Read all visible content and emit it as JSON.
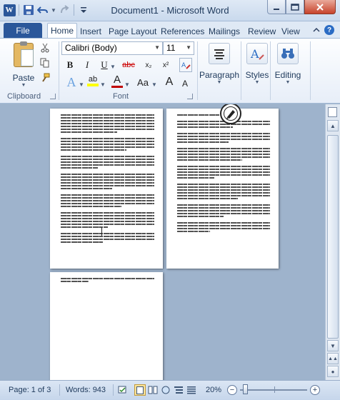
{
  "window": {
    "title": "Document1  -  Microsoft Word",
    "controls": [
      "minimize",
      "maximize",
      "close"
    ]
  },
  "quick_access": {
    "app_icon": "W",
    "items": [
      "save-icon",
      "undo-icon",
      "redo-icon",
      "customize-icon"
    ]
  },
  "tabs": {
    "file": "File",
    "items": [
      "Home",
      "Insert",
      "Page Layout",
      "References",
      "Mailings",
      "Review",
      "View"
    ],
    "active": "Home"
  },
  "ribbon": {
    "clipboard": {
      "paste_label": "Paste",
      "group_label": "Clipboard"
    },
    "font": {
      "family": "Calibri (Body)",
      "size": "11",
      "group_label": "Font",
      "buttons": [
        "B",
        "I",
        "U",
        "abc",
        "x₂",
        "x²",
        "A",
        "ab",
        "A",
        "Aa",
        "A",
        "A"
      ]
    },
    "paragraph": {
      "label": "Paragraph"
    },
    "styles": {
      "label": "Styles"
    },
    "editing": {
      "label": "Editing"
    }
  },
  "status": {
    "page": "Page: 1 of 3",
    "words": "Words: 943",
    "zoom": "20%",
    "zoom_level": 0.2
  },
  "colors": {
    "file_tab": "#2b579a",
    "highlight": "#ffff00",
    "font_color": "#c00000",
    "doc_background": "#9eb3cc"
  }
}
